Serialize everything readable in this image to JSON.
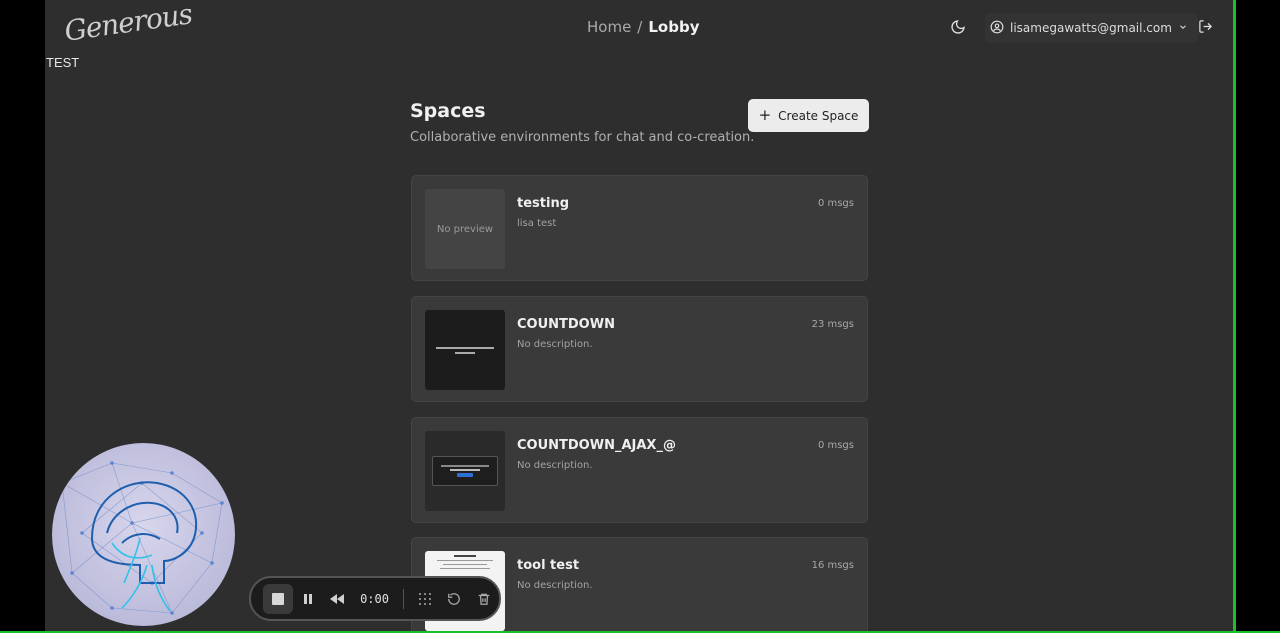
{
  "header": {
    "logo_text": "Generous",
    "logo_sub": "TEST",
    "breadcrumb": {
      "home": "Home",
      "separator": "/",
      "current": "Lobby"
    },
    "theme_icon": "moon-icon",
    "user_email": "lisamegawatts@gmail.com",
    "logout_icon": "logout-icon"
  },
  "spaces": {
    "title": "Spaces",
    "subtitle": "Collaborative environments for chat and co-creation.",
    "create_label": "Create Space",
    "items": [
      {
        "title": "testing",
        "description": "lisa test",
        "count": "0 msgs",
        "thumb_text": "No preview"
      },
      {
        "title": "COUNTDOWN",
        "description": "No description.",
        "count": "23 msgs",
        "thumb_text": ""
      },
      {
        "title": "COUNTDOWN_AJAX_@",
        "description": "No description.",
        "count": "0 msgs",
        "thumb_text": ""
      },
      {
        "title": "tool test",
        "description": "No description.",
        "count": "16 msgs",
        "thumb_text": ""
      }
    ]
  },
  "recorder": {
    "time": "0:00"
  }
}
